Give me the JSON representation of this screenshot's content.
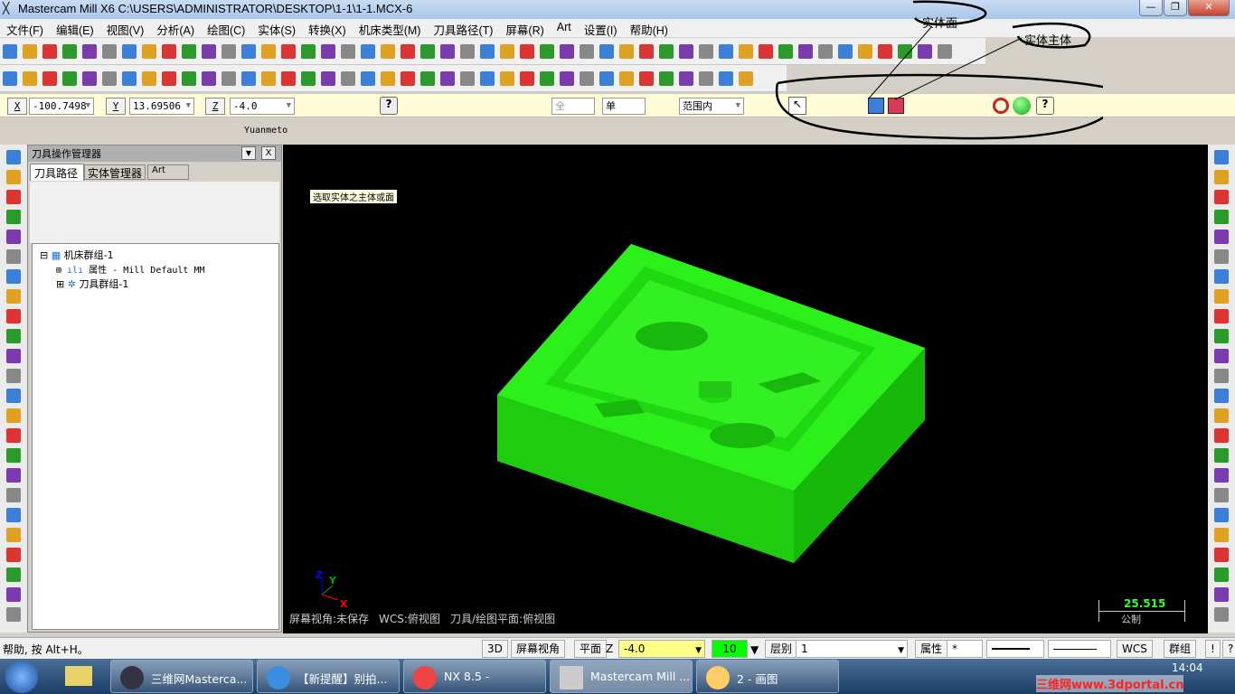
{
  "window": {
    "title": "Mastercam Mill X6  C:\\USERS\\ADMINISTRATOR\\DESKTOP\\1-1\\1-1.MCX-6",
    "min": "—",
    "max": "❐",
    "close": "✕"
  },
  "menu": [
    "文件(F)",
    "编辑(E)",
    "视图(V)",
    "分析(A)",
    "绘图(C)",
    "实体(S)",
    "转换(X)",
    "机床类型(M)",
    "刀具路径(T)",
    "屏幕(R)",
    "Art",
    "设置(I)",
    "帮助(H)"
  ],
  "annotations": {
    "face": "实体面",
    "body": "实体主体"
  },
  "coords": {
    "x_label": "X",
    "x_value": "-100.7498",
    "y_label": "Y",
    "y_value": "13.69506",
    "z_label": "Z",
    "z_value": "-4.0"
  },
  "selection": {
    "all": "全部...",
    "single": "单一...",
    "range": "范围内"
  },
  "user": "Yuanmeto",
  "panel": {
    "title": "刀具操作管理器",
    "tabs": [
      "刀具路径",
      "实体管理器",
      "Art"
    ],
    "tree": [
      "机床群组-1",
      "属性 - Mill Default MM",
      "刀具群组-1"
    ]
  },
  "viewport": {
    "tooltip": "选取实体之主体或面",
    "status": [
      "屏幕视角:未保存",
      "WCS:俯视图",
      "刀具/绘图平面:俯视图"
    ],
    "scale_value": "25.515",
    "scale_unit": "公制",
    "axes": {
      "x": "X",
      "y": "Y",
      "z": "Z"
    }
  },
  "status": {
    "help": "帮助, 按 Alt+H。",
    "btn_3d": "3D",
    "view": "屏幕视角",
    "plane": "平面",
    "z": "Z",
    "z_value": "-4.0",
    "color": "10",
    "level_label": "层别",
    "level": "1",
    "attr": "属性",
    "star": "*",
    "wcs": "WCS",
    "group": "群组",
    "bang": "!",
    "q": "?"
  },
  "taskbar": {
    "items": [
      "三维网Mastercа...",
      "【新提醒】别拍...",
      "NX 8.5 -",
      "Mastercam Mill ...",
      "2 - 画图"
    ],
    "time": "14:04",
    "watermark": "三维网www.3dportal.cn"
  }
}
